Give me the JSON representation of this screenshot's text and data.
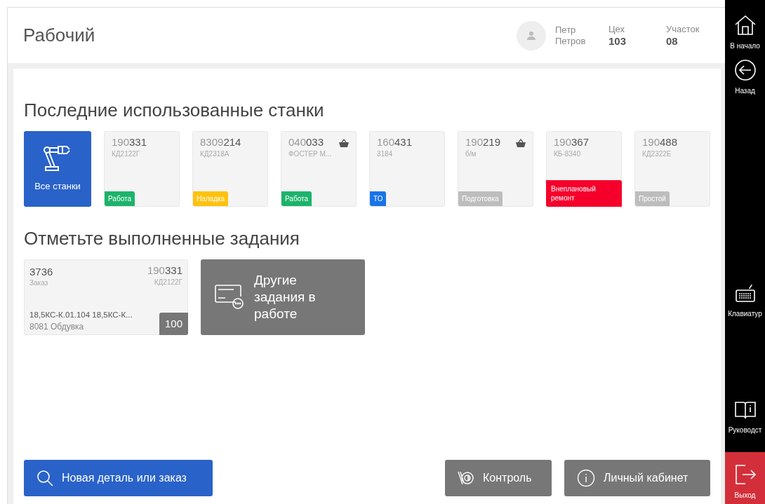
{
  "header": {
    "title": "Рабочий",
    "user": {
      "first_name": "Петр",
      "last_name": "Петров"
    },
    "workshop": {
      "label": "Цех",
      "value": "103"
    },
    "area": {
      "label": "Участок",
      "value": "08"
    }
  },
  "machines_section": {
    "title": "Последние использованные станки",
    "all_button": "Все станки",
    "machines": [
      {
        "code_prefix": "190",
        "code_suffix": "331",
        "model": "КД2122Г",
        "basket": false,
        "status": {
          "label": "Работа",
          "color": "#1db36b"
        }
      },
      {
        "code_prefix": "8309",
        "code_suffix": "214",
        "model": "КД2318А",
        "basket": false,
        "status": {
          "label": "Наладка",
          "color": "#ffc20e"
        }
      },
      {
        "code_prefix": "040",
        "code_suffix": "033",
        "model": "ФОСТЕР М...",
        "basket": true,
        "status": {
          "label": "Работа",
          "color": "#1db36b"
        }
      },
      {
        "code_prefix": "160",
        "code_suffix": "431",
        "model": "3184",
        "basket": false,
        "status": {
          "label": "ТО",
          "color": "#1a73e8"
        }
      },
      {
        "code_prefix": "190",
        "code_suffix": "219",
        "model": "б/м",
        "basket": true,
        "status": {
          "label": "Подготовка",
          "color": "#bdbdbd"
        }
      },
      {
        "code_prefix": "190",
        "code_suffix": "367",
        "model": "КБ-8340",
        "basket": false,
        "status": {
          "label": "Внеплановый ремонт",
          "color": "#f5002b"
        }
      },
      {
        "code_prefix": "190",
        "code_suffix": "488",
        "model": "КД2322Е",
        "basket": false,
        "status": {
          "label": "Простой",
          "color": "#bdbdbd"
        }
      }
    ]
  },
  "tasks_section": {
    "title": "Отметьте выполненные задания",
    "tasks": [
      {
        "order": "3736",
        "order_label": "Заказ",
        "code_prefix": "190",
        "code_suffix": "331",
        "model": "КД2122Г",
        "part": "18,5КС-К.01.104 18,5КС-К...",
        "operation": "8081 Обдувка",
        "quantity": "100"
      }
    ],
    "other_button": "Другие задания в работе"
  },
  "bottom_buttons": [
    {
      "kind": "search",
      "label": "Новая деталь или заказ"
    },
    {
      "kind": "control",
      "label": "Контроль"
    },
    {
      "kind": "info",
      "label": "Личный кабинет"
    }
  ],
  "sidebar": [
    {
      "kind": "home",
      "label": "В начало"
    },
    {
      "kind": "back",
      "label": "Назад"
    },
    {
      "kind": "keyboard",
      "label": "Клавиатур"
    },
    {
      "kind": "manual",
      "label": "Руководст"
    },
    {
      "kind": "exit",
      "label": "Выход"
    }
  ]
}
